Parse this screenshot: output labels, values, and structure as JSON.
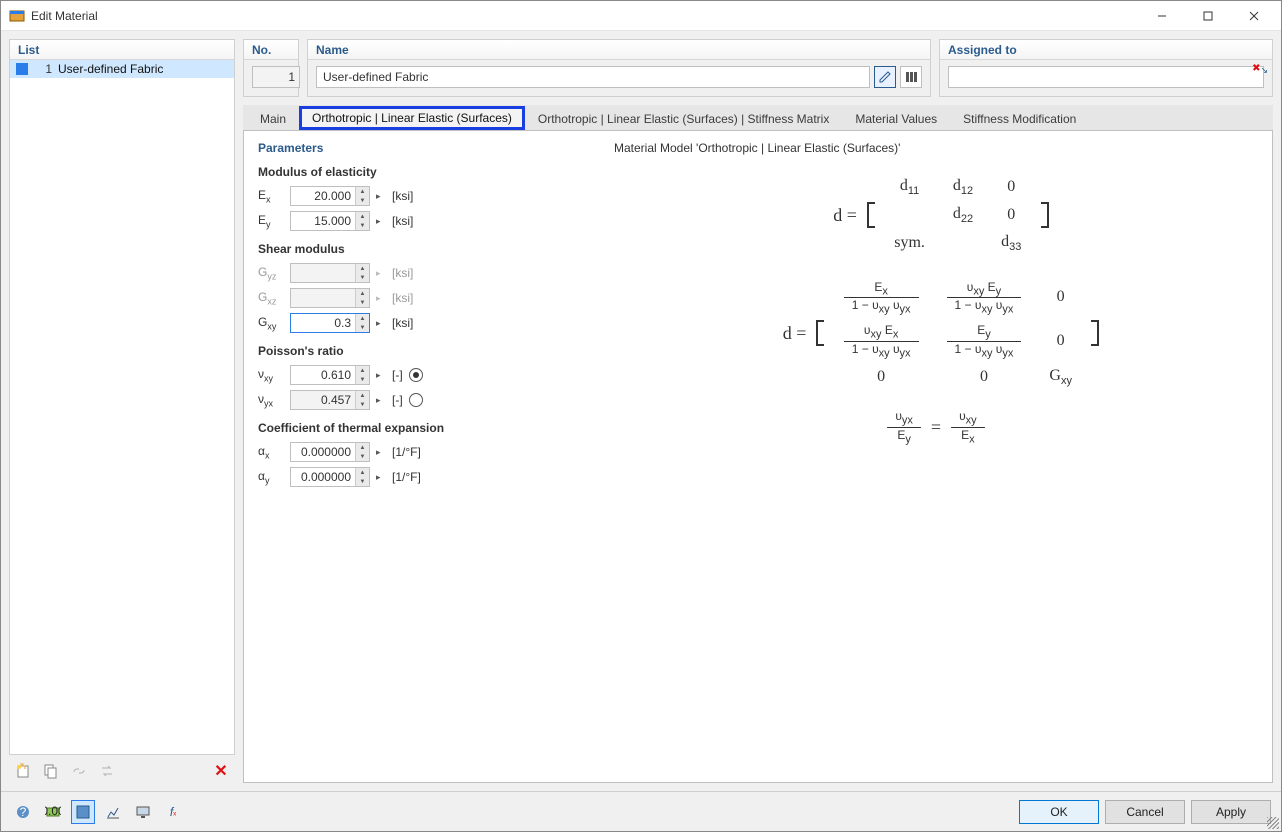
{
  "window": {
    "title": "Edit Material"
  },
  "left": {
    "header": "List",
    "items": [
      {
        "num": "1",
        "label": "User-defined Fabric"
      }
    ]
  },
  "top": {
    "no_label": "No.",
    "no_value": "1",
    "name_label": "Name",
    "name_value": "User-defined Fabric",
    "assigned_label": "Assigned to",
    "assigned_value": ""
  },
  "tabs": {
    "main": "Main",
    "ortho": "Orthotropic | Linear Elastic (Surfaces)",
    "ortho_stiff": "Orthotropic | Linear Elastic (Surfaces) | Stiffness Matrix",
    "matvals": "Material Values",
    "stiffmod": "Stiffness Modification"
  },
  "params": {
    "title": "Parameters",
    "modulus_head": "Modulus of elasticity",
    "Ex_label": "E",
    "Ex_sub": "x",
    "Ex_value": "20.000",
    "Ex_unit": "[ksi]",
    "Ey_label": "E",
    "Ey_sub": "y",
    "Ey_value": "15.000",
    "Ey_unit": "[ksi]",
    "shear_head": "Shear modulus",
    "Gyz_label": "G",
    "Gyz_sub": "yz",
    "Gyz_value": "",
    "Gyz_unit": "[ksi]",
    "Gxz_label": "G",
    "Gxz_sub": "xz",
    "Gxz_value": "",
    "Gxz_unit": "[ksi]",
    "Gxy_label": "G",
    "Gxy_sub": "xy",
    "Gxy_value": "0.3",
    "Gxy_unit": "[ksi]",
    "poisson_head": "Poisson's ratio",
    "vxy_label": "ν",
    "vxy_sub": "xy",
    "vxy_value": "0.610",
    "vxy_unit": "[-]",
    "vyx_label": "ν",
    "vyx_sub": "yx",
    "vyx_value": "0.457",
    "vyx_unit": "[-]",
    "thermal_head": "Coefficient of thermal expansion",
    "ax_label": "α",
    "ax_sub": "x",
    "ax_value": "0.000000",
    "ax_unit": "[1/°F]",
    "ay_label": "α",
    "ay_sub": "y",
    "ay_value": "0.000000",
    "ay_unit": "[1/°F]"
  },
  "model": {
    "title": "Material Model 'Orthotropic | Linear Elastic (Surfaces)'"
  },
  "buttons": {
    "ok": "OK",
    "cancel": "Cancel",
    "apply": "Apply"
  }
}
